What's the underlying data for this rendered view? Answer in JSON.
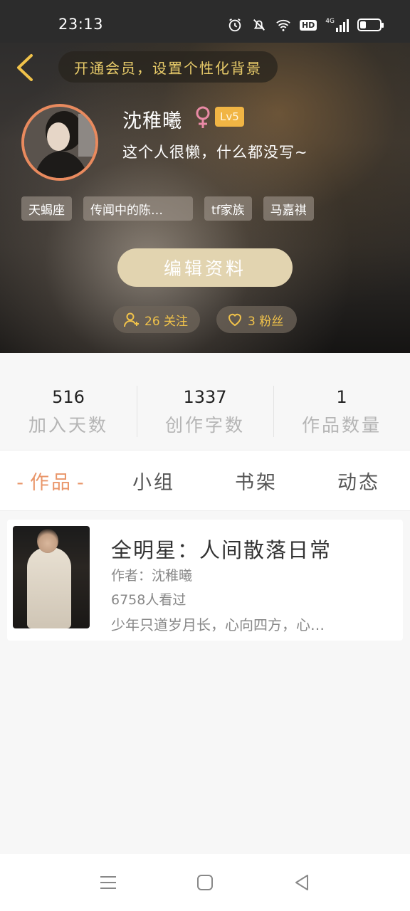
{
  "status_bar": {
    "time": "23:13",
    "network": "4G",
    "hd": "HD"
  },
  "header": {
    "vip_banner": "开通会员，设置个性化背景"
  },
  "profile": {
    "username": "沈稚曦",
    "gender": "♀",
    "level": "Lv5",
    "bio": "这个人很懒，什么都没写~",
    "tags": [
      "天蝎座",
      "传闻中的陈…",
      "tf家族",
      "马嘉祺"
    ],
    "edit_button": "编辑资料",
    "following_label": "26 关注",
    "fans_label": "3 粉丝"
  },
  "stats": [
    {
      "value": "516",
      "label": "加入天数"
    },
    {
      "value": "1337",
      "label": "创作字数"
    },
    {
      "value": "1",
      "label": "作品数量"
    }
  ],
  "tabs": [
    {
      "label": "作品",
      "active": true
    },
    {
      "label": "小组",
      "active": false
    },
    {
      "label": "书架",
      "active": false
    },
    {
      "label": "动态",
      "active": false
    }
  ],
  "tab_dash": "-",
  "work": {
    "title": "全明星：人间散落日常",
    "author": "作者：沈稚曦",
    "views": "6758人看过",
    "description": "少年只道岁月长，心向四方，心…"
  },
  "colors": {
    "accent": "#e9966a",
    "gold": "#f0c24a",
    "level_badge": "#f1b544",
    "edit_button": "#e2d4b0"
  }
}
